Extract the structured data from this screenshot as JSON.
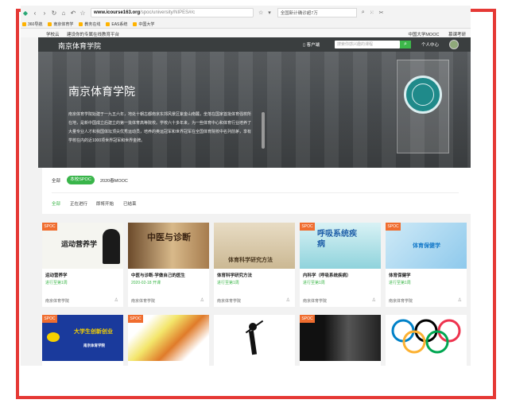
{
  "browser": {
    "url_domain": "www.icourse163.org",
    "url_path": "/spoc/university/NIPES#/c",
    "news": "全国新计确诊超7万",
    "bookmarks": [
      "360导航",
      "南京体育学",
      "教务在线",
      "EAS系统",
      "中国大学"
    ]
  },
  "site_top": {
    "left": [
      "学校云",
      "建设你的专属在线教育平台"
    ],
    "right": [
      "中国大学MOOC",
      "慕课考研"
    ]
  },
  "header": {
    "school_name": "南京体育学院",
    "client_label": "客户端",
    "search_placeholder": "搜索你感兴趣的课程",
    "personal_center": "个人中心"
  },
  "hero": {
    "title": "南京体育学院",
    "description": "南京体育学院始建于一九五六年，地处十朝古都南京东郊风景区紫金山南麓，坐落在国家首批体育强校所在地，是新中国成立后建立的第一批体育高等院校。学校六十多年来，为一些体育中心和体育行业培养了大量专业人才和我国体坛顶尖优秀运动员，培养的奥运冠军和世界冠军在全国体育院校中名列前茅，享有学校在内的近1000项世界冠军和世界金牌。"
  },
  "filters": {
    "row1": [
      "全部",
      "本校SPOC",
      "2020春MOOC"
    ],
    "row2": [
      "全部",
      "正在进行",
      "即将开始",
      "已结束"
    ]
  },
  "courses": [
    {
      "title": "运动营养学",
      "status": "进行至第1周",
      "school": "南京体育学院",
      "tag": "SPOC",
      "thumb_text": "运动营养学"
    },
    {
      "title": "中医与诊断-学做自己的医生",
      "status": "2020-02-18 开课",
      "school": "南京体育学院",
      "tag": "SPOC",
      "thumb_text": "中医与诊断"
    },
    {
      "title": "体育科学研究方法",
      "status": "进行至第1周",
      "school": "南京体育学院",
      "tag": "SPOC",
      "thumb_text": "体育科学研究方法"
    },
    {
      "title": "内科学（呼吸系统疾病）",
      "status": "进行至第1周",
      "school": "南京体育学院",
      "tag": "SPOC",
      "thumb_text": "呼吸系统疾病"
    },
    {
      "title": "体育保健学",
      "status": "进行至第1周",
      "school": "南京体育学院",
      "tag": "SPOC",
      "thumb_text": "体育保健学"
    },
    {
      "tag": "SPOC",
      "thumb_text": "大学生创新创业",
      "thumb_sub": "南京体育学院"
    },
    {
      "tag": "SPOC",
      "thumb_text": ""
    },
    {
      "tag": "",
      "thumb_text": ""
    },
    {
      "tag": "SPOC",
      "thumb_text": ""
    },
    {
      "tag": "",
      "thumb_text": ""
    }
  ],
  "colors": {
    "accent_green": "#3db74a",
    "spoc_orange": "#f06d2f",
    "frame_red": "#e53935",
    "header_dark": "#3a3e3f"
  }
}
